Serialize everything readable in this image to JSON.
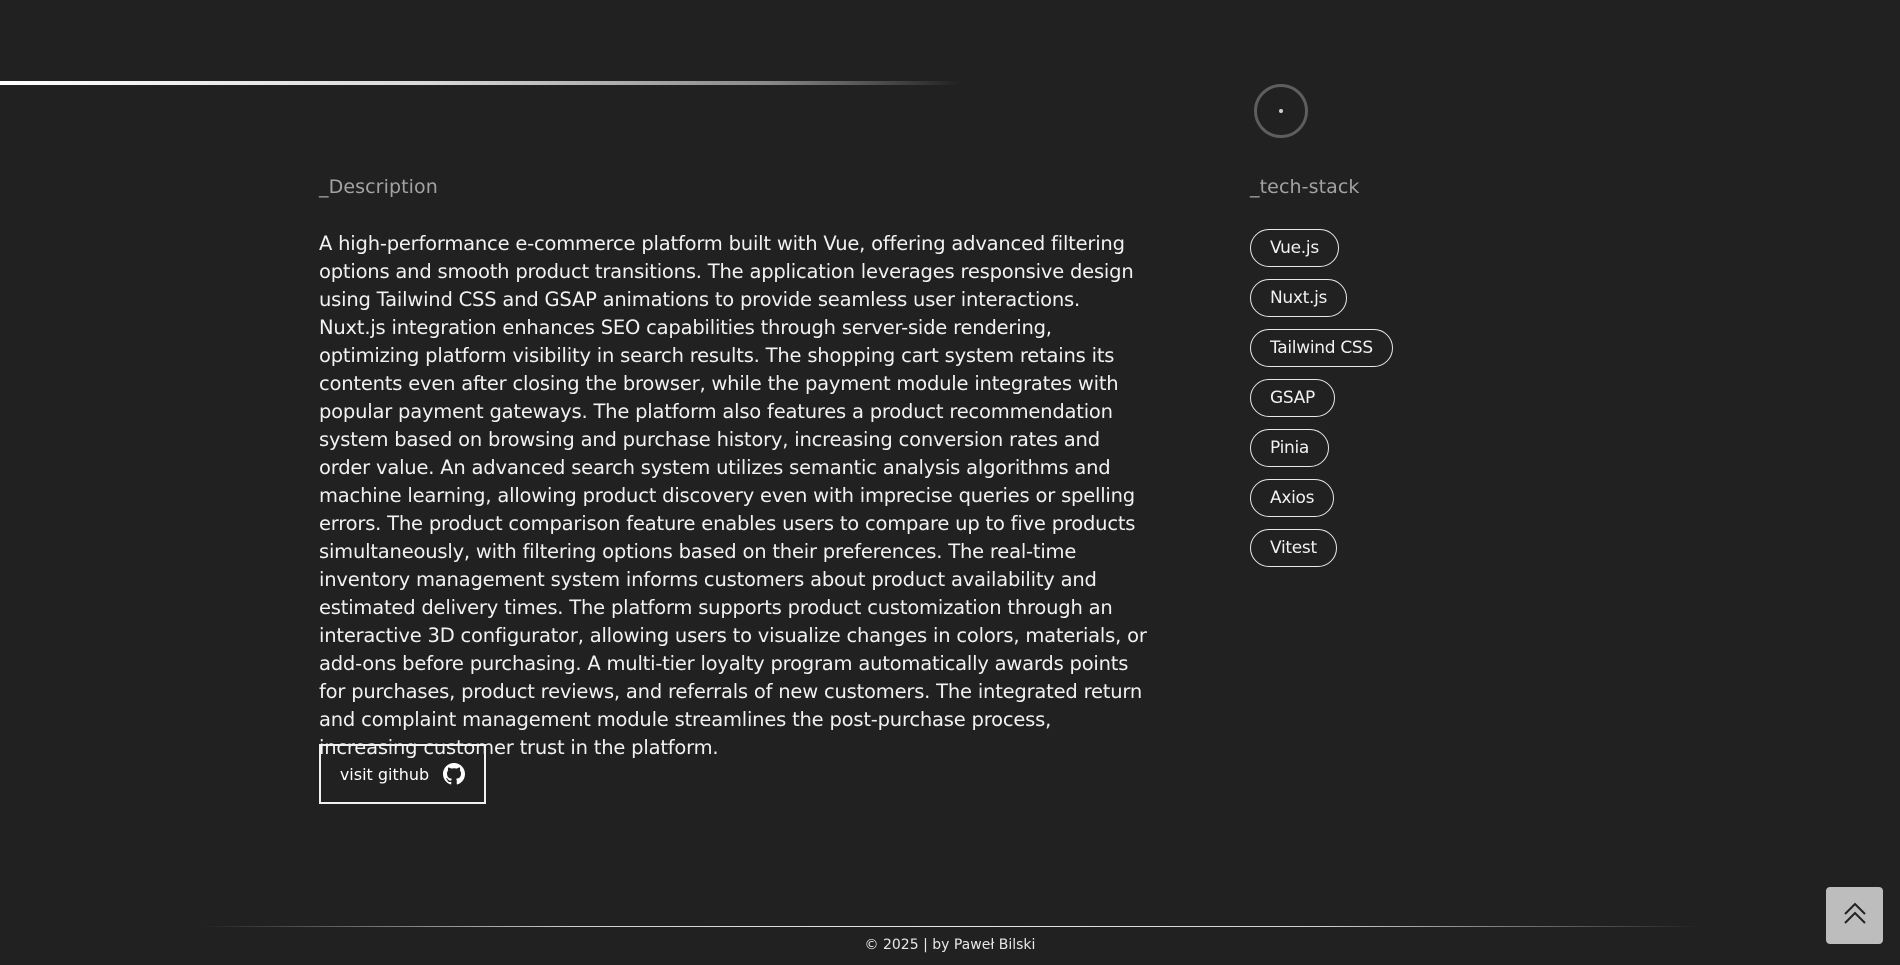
{
  "description": {
    "title": "_Description",
    "text": "A high-performance e-commerce platform built with Vue, offering advanced filtering options and smooth product transitions. The application leverages responsive design using Tailwind CSS and GSAP animations to provide seamless user interactions. Nuxt.js integration enhances SEO capabilities through server-side rendering, optimizing platform visibility in search results. The shopping cart system retains its contents even after closing the browser, while the payment module integrates with popular payment gateways. The platform also features a product recommendation system based on browsing and purchase history, increasing conversion rates and order value. An advanced search system utilizes semantic analysis algorithms and machine learning, allowing product discovery even with imprecise queries or spelling errors. The product comparison feature enables users to compare up to five products simultaneously, with filtering options based on their preferences. The real-time inventory management system informs customers about product availability and estimated delivery times. The platform supports product customization through an interactive 3D configurator, allowing users to visualize changes in colors, materials, or add-ons before purchasing. A multi-tier loyalty program automatically awards points for purchases, product reviews, and referrals of new customers. The integrated return and complaint management module streamlines the post-purchase process, increasing customer trust in the platform.",
    "github_button_label": "visit github",
    "github_icon": "github-icon"
  },
  "tech_stack": {
    "title": "_tech-stack",
    "items": [
      "Vue.js",
      "Nuxt.js",
      "Tailwind CSS",
      "GSAP",
      "Pinia",
      "Axios",
      "Vitest"
    ]
  },
  "footer": {
    "text": "© 2025 | by Paweł Bilski"
  },
  "back_to_top_icon": "double-chevron-up-icon",
  "colors": {
    "background": "#212121",
    "text": "#f2f2f2",
    "muted": "#a3a3a3",
    "back_to_top_bg": "#bdbdbd"
  }
}
